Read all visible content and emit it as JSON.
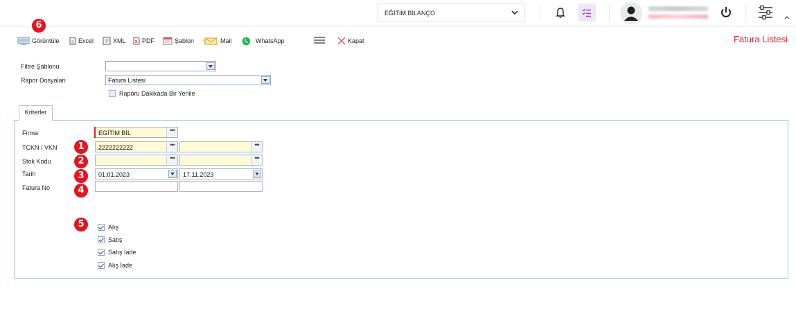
{
  "header": {
    "company_selector_value": "EĞİTİM BİLANÇO",
    "icons": [
      "chevron-down-icon",
      "bell-icon",
      "tasks-icon",
      "user-avatar-icon",
      "power-icon",
      "sliders-icon",
      "chevron-up-icon"
    ]
  },
  "toolbar": {
    "view_label": "Görüntüle",
    "excel_label": "Excel",
    "xml_label": "XML",
    "pdf_label": "PDF",
    "template_label": "Şablon",
    "mail_label": "Mail",
    "whatsapp_label": "WhatsApp",
    "close_label": "Kapat"
  },
  "page_title": "Fatura Listesi",
  "filters": {
    "template_label": "Filtre Şablonu",
    "template_value": "",
    "report_file_label": "Rapor Dosyaları",
    "report_file_value": "Fatura Listesi",
    "refresh_label": "Raporu Dakikada Bir Yenile",
    "refresh_checked": false
  },
  "tabs": [
    {
      "label": "Kriterler"
    }
  ],
  "criteria": {
    "firm_label": "Firma",
    "firm_value": "EGİTİM BİL",
    "tckn_label": "TCKN / VKN",
    "tckn_from": "2222222222",
    "tckn_to": "",
    "stock_label": "Stok Kodu",
    "stock_from": "",
    "stock_to": "",
    "date_label": "Tarih",
    "date_from": "01.01.2023",
    "date_to": "17.11.2023",
    "invoice_no_label": "Fatura No",
    "invoice_no_from": "",
    "invoice_no_to": ""
  },
  "invoice_types": [
    {
      "label": "Alış",
      "checked": true
    },
    {
      "label": "Satış",
      "checked": true
    },
    {
      "label": "Satış İade",
      "checked": true
    },
    {
      "label": "Alış İade",
      "checked": true
    }
  ],
  "annotations": [
    "1",
    "2",
    "3",
    "4",
    "5",
    "6"
  ],
  "colors": {
    "accent_red": "#e0202f",
    "badge_red": "#e5141f",
    "field_yellow": "#fdfbd7",
    "border_blue": "#a9c0dc"
  }
}
